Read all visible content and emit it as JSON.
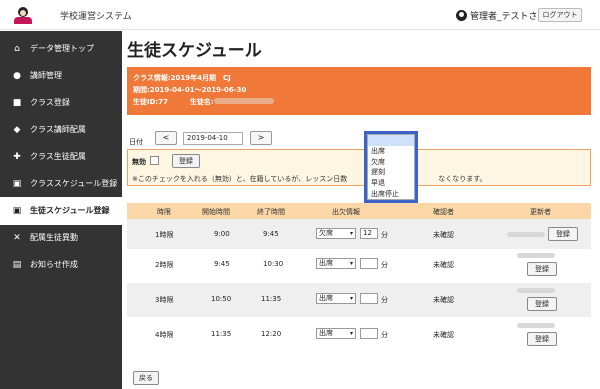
{
  "app": {
    "title": "学校運営システム",
    "user": "管理者_テストさん",
    "logout": "ログアウト"
  },
  "sidebar": {
    "items": [
      {
        "label": "データ管理トップ",
        "icon": "home-icon"
      },
      {
        "label": "講師管理",
        "icon": "users-icon"
      },
      {
        "label": "クラス登録",
        "icon": "book-icon"
      },
      {
        "label": "クラス講師配属",
        "icon": "graduation-cap-icon"
      },
      {
        "label": "クラス生徒配属",
        "icon": "add-user-icon"
      },
      {
        "label": "クラススケジュール登録",
        "icon": "calendar-user-icon"
      },
      {
        "label": "生徒スケジュール登録",
        "icon": "calendar-user-icon"
      },
      {
        "label": "配属生徒異動",
        "icon": "shuffle-icon"
      },
      {
        "label": "お知らせ作成",
        "icon": "message-icon"
      }
    ]
  },
  "page": {
    "title": "生徒スケジュール"
  },
  "info": {
    "class_info": "クラス情報:2019年4月期　CJ",
    "period": "期間:2019-04-01～2019-06-30",
    "student_id": "生徒ID:77",
    "student_name_label": "生徒名:"
  },
  "date": {
    "label": "日付",
    "prev": "<",
    "value": "2019-04-10",
    "next": ">"
  },
  "absent": {
    "label": "無効",
    "register": "登録",
    "note": "※このチェックを入れる（無効）と、在籍しているが、レッスン日数　　　　　　　　　　　　　なくなります。"
  },
  "table": {
    "headers": [
      "時限",
      "開始時間",
      "終了時間",
      "出欠情報",
      "確認者",
      "更新者"
    ],
    "rows": [
      {
        "period": "1時限",
        "start": "9:00",
        "end": "9:45",
        "status": "欠席",
        "minutes": "12",
        "unit": "分",
        "confirmer": "未確認",
        "action": "登録"
      },
      {
        "period": "2時限",
        "start": "9:45",
        "end": "10:30",
        "status": "出席",
        "minutes": "",
        "unit": "分",
        "confirmer": "未確認",
        "action": "登録"
      },
      {
        "period": "3時限",
        "start": "10:50",
        "end": "11:35",
        "status": "出席",
        "minutes": "",
        "unit": "分",
        "confirmer": "未確認",
        "action": "登録"
      },
      {
        "period": "4時限",
        "start": "11:35",
        "end": "12:20",
        "status": "出席",
        "minutes": "",
        "unit": "分",
        "confirmer": "未確認",
        "action": "登録"
      }
    ]
  },
  "dropdown": {
    "options": [
      "",
      "出席",
      "欠席",
      "遅刻",
      "早退",
      "出席停止"
    ]
  },
  "back": "戻る"
}
